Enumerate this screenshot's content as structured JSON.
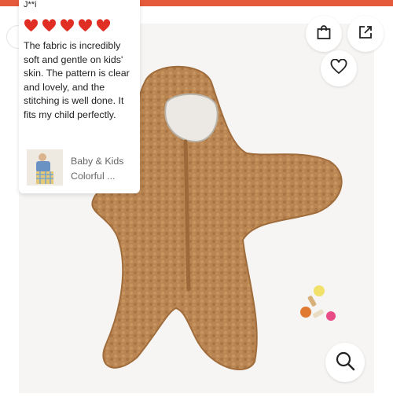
{
  "review": {
    "reviewer": "J**i",
    "rating": 5,
    "text": "The fabric is incredibly soft and gentle on kids' skin. The pattern is clear and lovely, and the stitching is well done. It fits my child perfectly.",
    "product_title": "Baby & Kids Colorful ..."
  },
  "icons": {
    "bag": "shopping-bag-icon",
    "share": "share-icon",
    "wishlist": "heart-icon",
    "zoom": "search-icon"
  },
  "colors": {
    "accent": "#e55a3a",
    "heart": "#e02e24",
    "fabric": "#b98552"
  }
}
